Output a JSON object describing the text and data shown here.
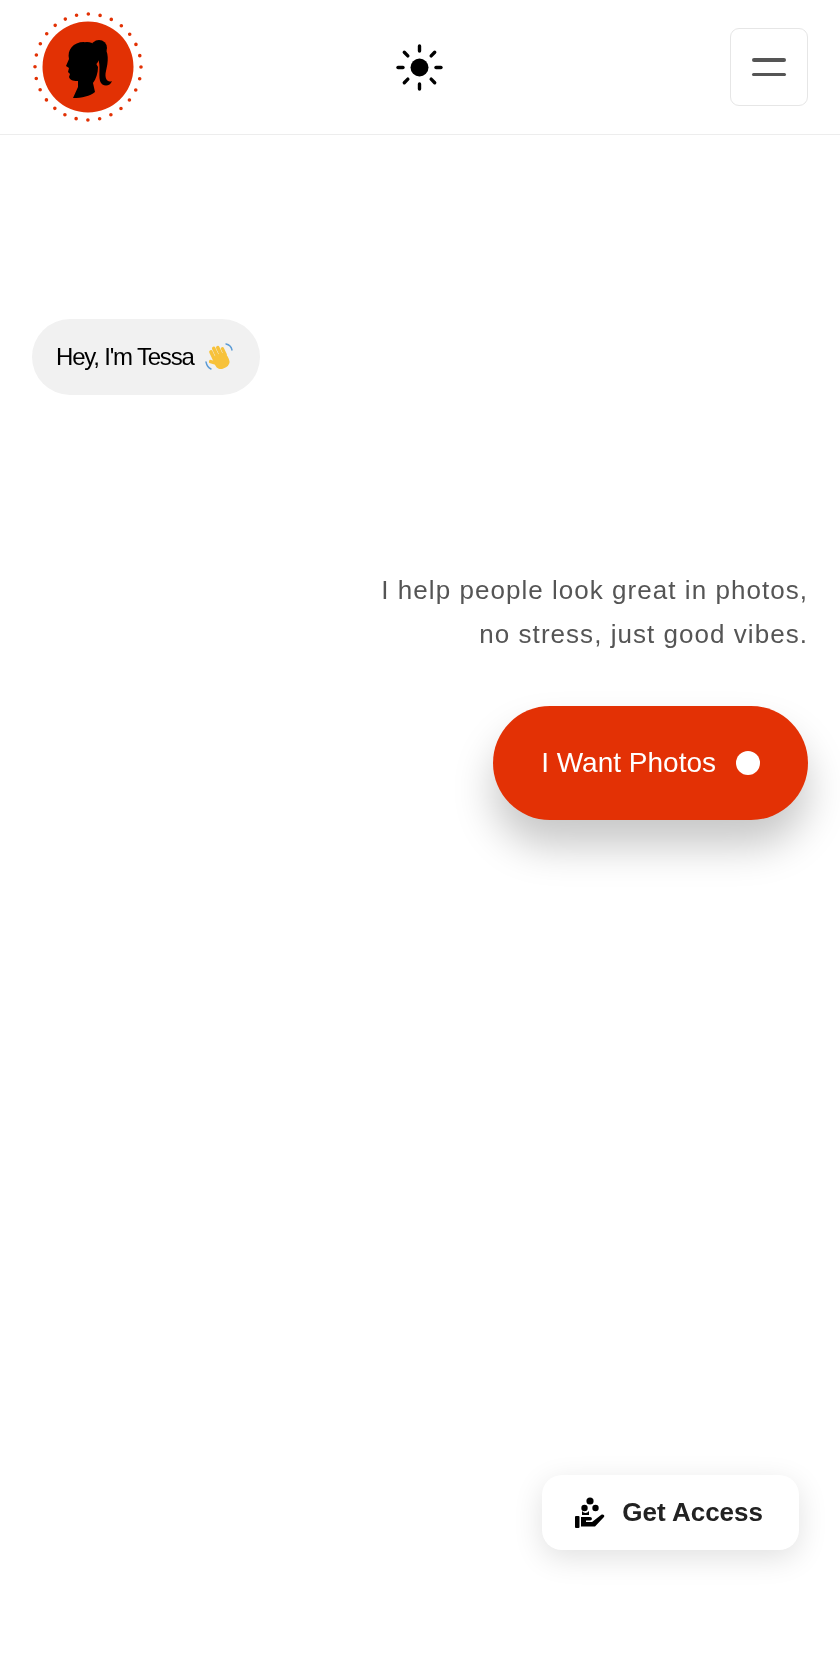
{
  "header": {
    "dark_mode": false
  },
  "greeting": {
    "text": "Hey, I'm Tessa"
  },
  "intro": {
    "lines": [
      "I help people look great in photos,",
      "no stress, just good vibes."
    ]
  },
  "cta": {
    "label": "I Want Photos"
  },
  "access_button": {
    "label": "Get Access"
  }
}
